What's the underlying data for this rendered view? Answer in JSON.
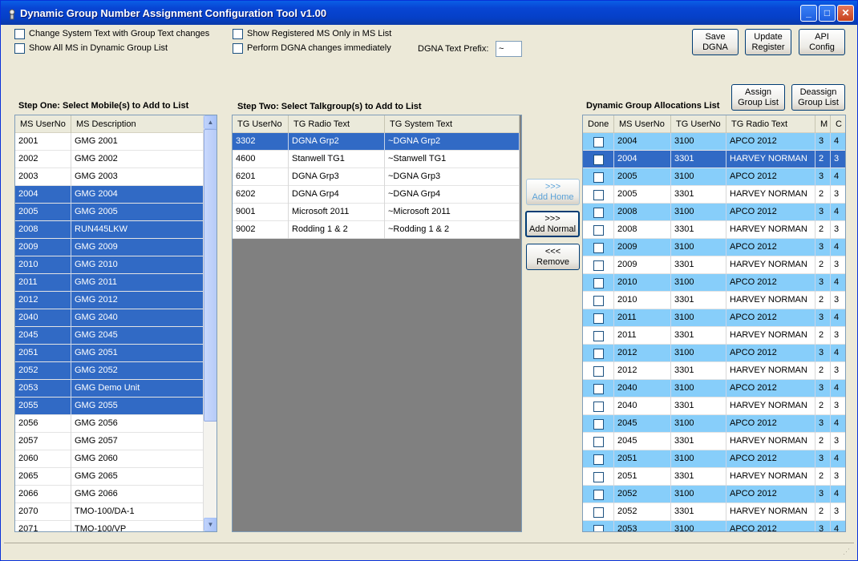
{
  "window": {
    "title": "Dynamic Group Number Assignment Configuration Tool v1.00"
  },
  "options": {
    "change_system_text": "Change System Text with Group Text changes",
    "show_all_ms": "Show All MS in Dynamic Group List",
    "show_registered": "Show Registered MS Only in MS List",
    "perform_immediately": "Perform DGNA changes immediately",
    "prefix_label": "DGNA Text Prefix:",
    "prefix_value": "~"
  },
  "buttons": {
    "save": [
      "Save",
      "DGNA"
    ],
    "update": [
      "Update",
      "Register"
    ],
    "api": [
      "API",
      "Config"
    ],
    "assign": [
      "Assign",
      "Group List"
    ],
    "deassign": [
      "Deassign",
      "Group List"
    ],
    "add_home": [
      ">>>",
      "Add Home"
    ],
    "add_normal": [
      ">>>",
      "Add Normal"
    ],
    "remove": [
      "<<<",
      "Remove"
    ]
  },
  "step_one": {
    "title": "Step One: Select Mobile(s) to Add to List",
    "columns": [
      "MS UserNo",
      "MS Description"
    ],
    "rows": [
      {
        "no": "2001",
        "desc": "GMG 2001",
        "sel": false
      },
      {
        "no": "2002",
        "desc": "GMG 2002",
        "sel": false
      },
      {
        "no": "2003",
        "desc": "GMG 2003",
        "sel": false
      },
      {
        "no": "2004",
        "desc": "GMG 2004",
        "sel": true
      },
      {
        "no": "2005",
        "desc": "GMG 2005",
        "sel": true
      },
      {
        "no": "2008",
        "desc": "RUN445LKW",
        "sel": true
      },
      {
        "no": "2009",
        "desc": "GMG 2009",
        "sel": true
      },
      {
        "no": "2010",
        "desc": "GMG 2010",
        "sel": true
      },
      {
        "no": "2011",
        "desc": "GMG 2011",
        "sel": true
      },
      {
        "no": "2012",
        "desc": "GMG 2012",
        "sel": true
      },
      {
        "no": "2040",
        "desc": "GMG 2040",
        "sel": true
      },
      {
        "no": "2045",
        "desc": "GMG 2045",
        "sel": true
      },
      {
        "no": "2051",
        "desc": "GMG 2051",
        "sel": true
      },
      {
        "no": "2052",
        "desc": "GMG 2052",
        "sel": true
      },
      {
        "no": "2053",
        "desc": "GMG Demo Unit",
        "sel": true
      },
      {
        "no": "2055",
        "desc": "GMG 2055",
        "sel": true
      },
      {
        "no": "2056",
        "desc": "GMG 2056",
        "sel": false
      },
      {
        "no": "2057",
        "desc": "GMG 2057",
        "sel": false
      },
      {
        "no": "2060",
        "desc": "GMG 2060",
        "sel": false
      },
      {
        "no": "2065",
        "desc": "GMG 2065",
        "sel": false
      },
      {
        "no": "2066",
        "desc": "GMG 2066",
        "sel": false
      },
      {
        "no": "2070",
        "desc": "TMO-100/DA-1",
        "sel": false
      },
      {
        "no": "2071",
        "desc": "TMO-100/VP",
        "sel": false
      }
    ]
  },
  "step_two": {
    "title": "Step Two: Select Talkgroup(s) to Add to List",
    "columns": [
      "TG UserNo",
      "TG Radio Text",
      "TG System Text"
    ],
    "rows": [
      {
        "no": "3302",
        "radio": "DGNA Grp2",
        "system": "~DGNA Grp2",
        "sel": true
      },
      {
        "no": "4600",
        "radio": "Stanwell TG1",
        "system": "~Stanwell TG1",
        "sel": false
      },
      {
        "no": "6201",
        "radio": "DGNA Grp3",
        "system": "~DGNA Grp3",
        "sel": false
      },
      {
        "no": "6202",
        "radio": "DGNA Grp4",
        "system": "~DGNA Grp4",
        "sel": false
      },
      {
        "no": "9001",
        "radio": "Microsoft 2011",
        "system": "~Microsoft 2011",
        "sel": false
      },
      {
        "no": "9002",
        "radio": "Rodding 1 & 2",
        "system": "~Rodding 1 & 2",
        "sel": false
      }
    ]
  },
  "allocations": {
    "title": "Dynamic Group Allocations List",
    "columns": [
      "Done",
      "MS UserNo",
      "TG UserNo",
      "TG Radio Text",
      "M",
      "C"
    ],
    "rows": [
      {
        "ms": "2004",
        "tg": "3100",
        "text": "APCO 2012",
        "m": "3",
        "c": "4",
        "style": "lb"
      },
      {
        "ms": "2004",
        "tg": "3301",
        "text": "HARVEY NORMAN",
        "m": "2",
        "c": "3",
        "style": "sel"
      },
      {
        "ms": "2005",
        "tg": "3100",
        "text": "APCO 2012",
        "m": "3",
        "c": "4",
        "style": "lb"
      },
      {
        "ms": "2005",
        "tg": "3301",
        "text": "HARVEY NORMAN",
        "m": "2",
        "c": "3",
        "style": ""
      },
      {
        "ms": "2008",
        "tg": "3100",
        "text": "APCO 2012",
        "m": "3",
        "c": "4",
        "style": "lb"
      },
      {
        "ms": "2008",
        "tg": "3301",
        "text": "HARVEY NORMAN",
        "m": "2",
        "c": "3",
        "style": ""
      },
      {
        "ms": "2009",
        "tg": "3100",
        "text": "APCO 2012",
        "m": "3",
        "c": "4",
        "style": "lb"
      },
      {
        "ms": "2009",
        "tg": "3301",
        "text": "HARVEY NORMAN",
        "m": "2",
        "c": "3",
        "style": ""
      },
      {
        "ms": "2010",
        "tg": "3100",
        "text": "APCO 2012",
        "m": "3",
        "c": "4",
        "style": "lb"
      },
      {
        "ms": "2010",
        "tg": "3301",
        "text": "HARVEY NORMAN",
        "m": "2",
        "c": "3",
        "style": ""
      },
      {
        "ms": "2011",
        "tg": "3100",
        "text": "APCO 2012",
        "m": "3",
        "c": "4",
        "style": "lb"
      },
      {
        "ms": "2011",
        "tg": "3301",
        "text": "HARVEY NORMAN",
        "m": "2",
        "c": "3",
        "style": ""
      },
      {
        "ms": "2012",
        "tg": "3100",
        "text": "APCO 2012",
        "m": "3",
        "c": "4",
        "style": "lb"
      },
      {
        "ms": "2012",
        "tg": "3301",
        "text": "HARVEY NORMAN",
        "m": "2",
        "c": "3",
        "style": ""
      },
      {
        "ms": "2040",
        "tg": "3100",
        "text": "APCO 2012",
        "m": "3",
        "c": "4",
        "style": "lb"
      },
      {
        "ms": "2040",
        "tg": "3301",
        "text": "HARVEY NORMAN",
        "m": "2",
        "c": "3",
        "style": ""
      },
      {
        "ms": "2045",
        "tg": "3100",
        "text": "APCO 2012",
        "m": "3",
        "c": "4",
        "style": "lb"
      },
      {
        "ms": "2045",
        "tg": "3301",
        "text": "HARVEY NORMAN",
        "m": "2",
        "c": "3",
        "style": ""
      },
      {
        "ms": "2051",
        "tg": "3100",
        "text": "APCO 2012",
        "m": "3",
        "c": "4",
        "style": "lb"
      },
      {
        "ms": "2051",
        "tg": "3301",
        "text": "HARVEY NORMAN",
        "m": "2",
        "c": "3",
        "style": ""
      },
      {
        "ms": "2052",
        "tg": "3100",
        "text": "APCO 2012",
        "m": "3",
        "c": "4",
        "style": "lb"
      },
      {
        "ms": "2052",
        "tg": "3301",
        "text": "HARVEY NORMAN",
        "m": "2",
        "c": "3",
        "style": ""
      },
      {
        "ms": "2053",
        "tg": "3100",
        "text": "APCO 2012",
        "m": "3",
        "c": "4",
        "style": "lb"
      }
    ]
  }
}
